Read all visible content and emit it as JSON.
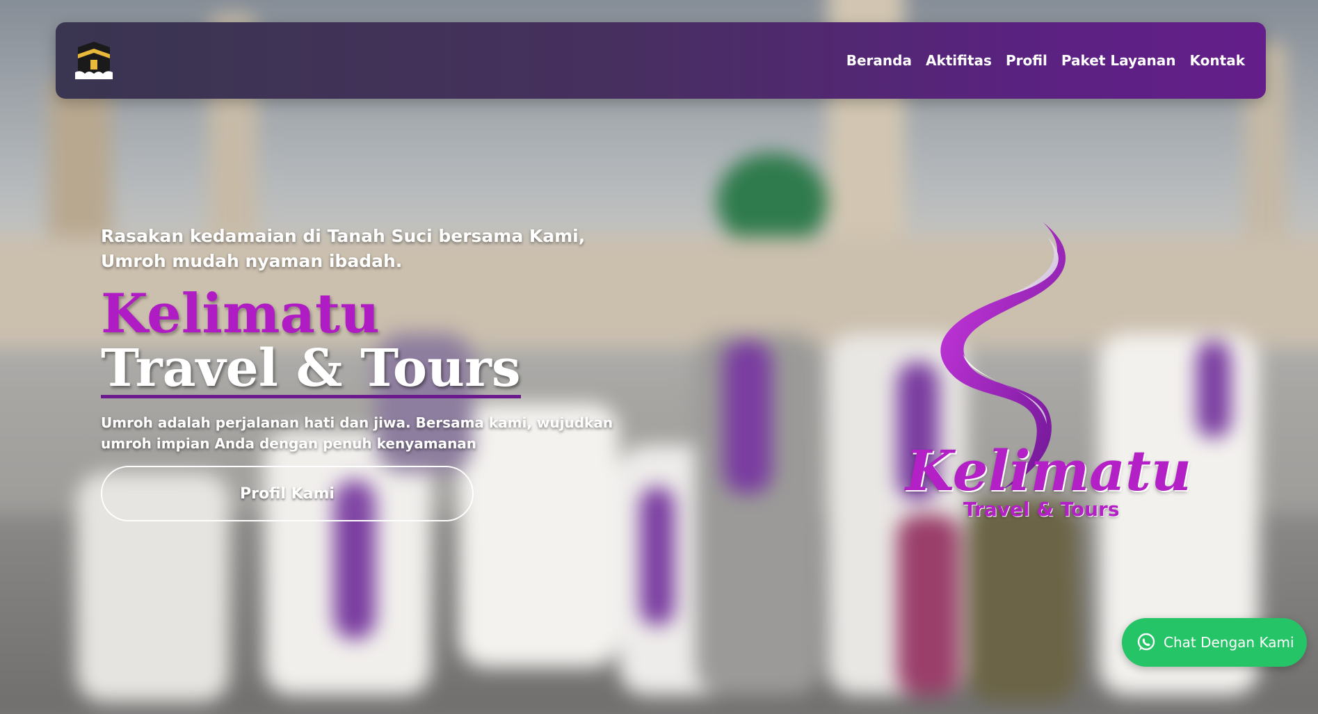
{
  "nav": {
    "logo_icon": "kaaba-icon",
    "links": [
      "Beranda",
      "Aktifitas",
      "Profil",
      "Paket Layanan",
      "Kontak"
    ]
  },
  "hero": {
    "tagline": "Rasakan kedamaian di Tanah Suci bersama Kami, Umroh mudah nyaman ibadah.",
    "brand_line1": "Kelimatu",
    "brand_line2": "Travel & Tours",
    "description": "Umroh adalah perjalanan hati dan jiwa. Bersama kami, wujudkan umroh impian Anda dengan penuh kenyamanan",
    "button_label": "Profil Kami"
  },
  "logo": {
    "wordmark": "Kelimatu",
    "subtitle": "Travel & Tours"
  },
  "chat": {
    "label": "Chat Dengan Kami",
    "icon": "whatsapp-icon"
  },
  "colors": {
    "brand_purple": "#b01cc4",
    "nav_gradient_start": "#3a3550",
    "nav_gradient_end": "#641e8a",
    "chat_green": "#25c466"
  }
}
